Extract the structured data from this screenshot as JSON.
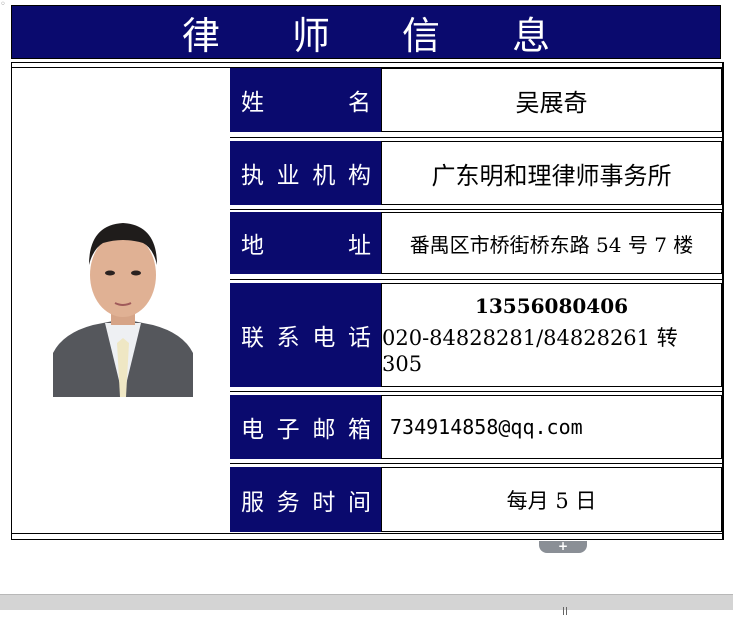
{
  "title": "律 师 信 息",
  "rows": [
    {
      "label_chars": [
        "姓",
        "名"
      ],
      "value": "吴展奇"
    },
    {
      "label_chars": [
        "执",
        "业",
        "机",
        "构"
      ],
      "value": "广东明和理律师事务所"
    },
    {
      "label_chars": [
        "地",
        "址"
      ],
      "value": "番禺区市桥街桥东路 54 号 7 楼"
    },
    {
      "label_chars": [
        "联",
        "系",
        "电",
        "话"
      ],
      "value_mobile": "13556080406",
      "value_phone": "020-84828281/84828261 转 305"
    },
    {
      "label_chars": [
        "电",
        "子",
        "邮",
        "箱"
      ],
      "value": "734914858@qq.com"
    },
    {
      "label_chars": [
        "服",
        "务",
        "时",
        "间"
      ],
      "value": "每月 5 日"
    }
  ],
  "expand_button_label": "+",
  "colors": {
    "header_bg": "#0a0a6e",
    "label_bg": "#0a0a6e",
    "label_text": "#ffffff"
  }
}
